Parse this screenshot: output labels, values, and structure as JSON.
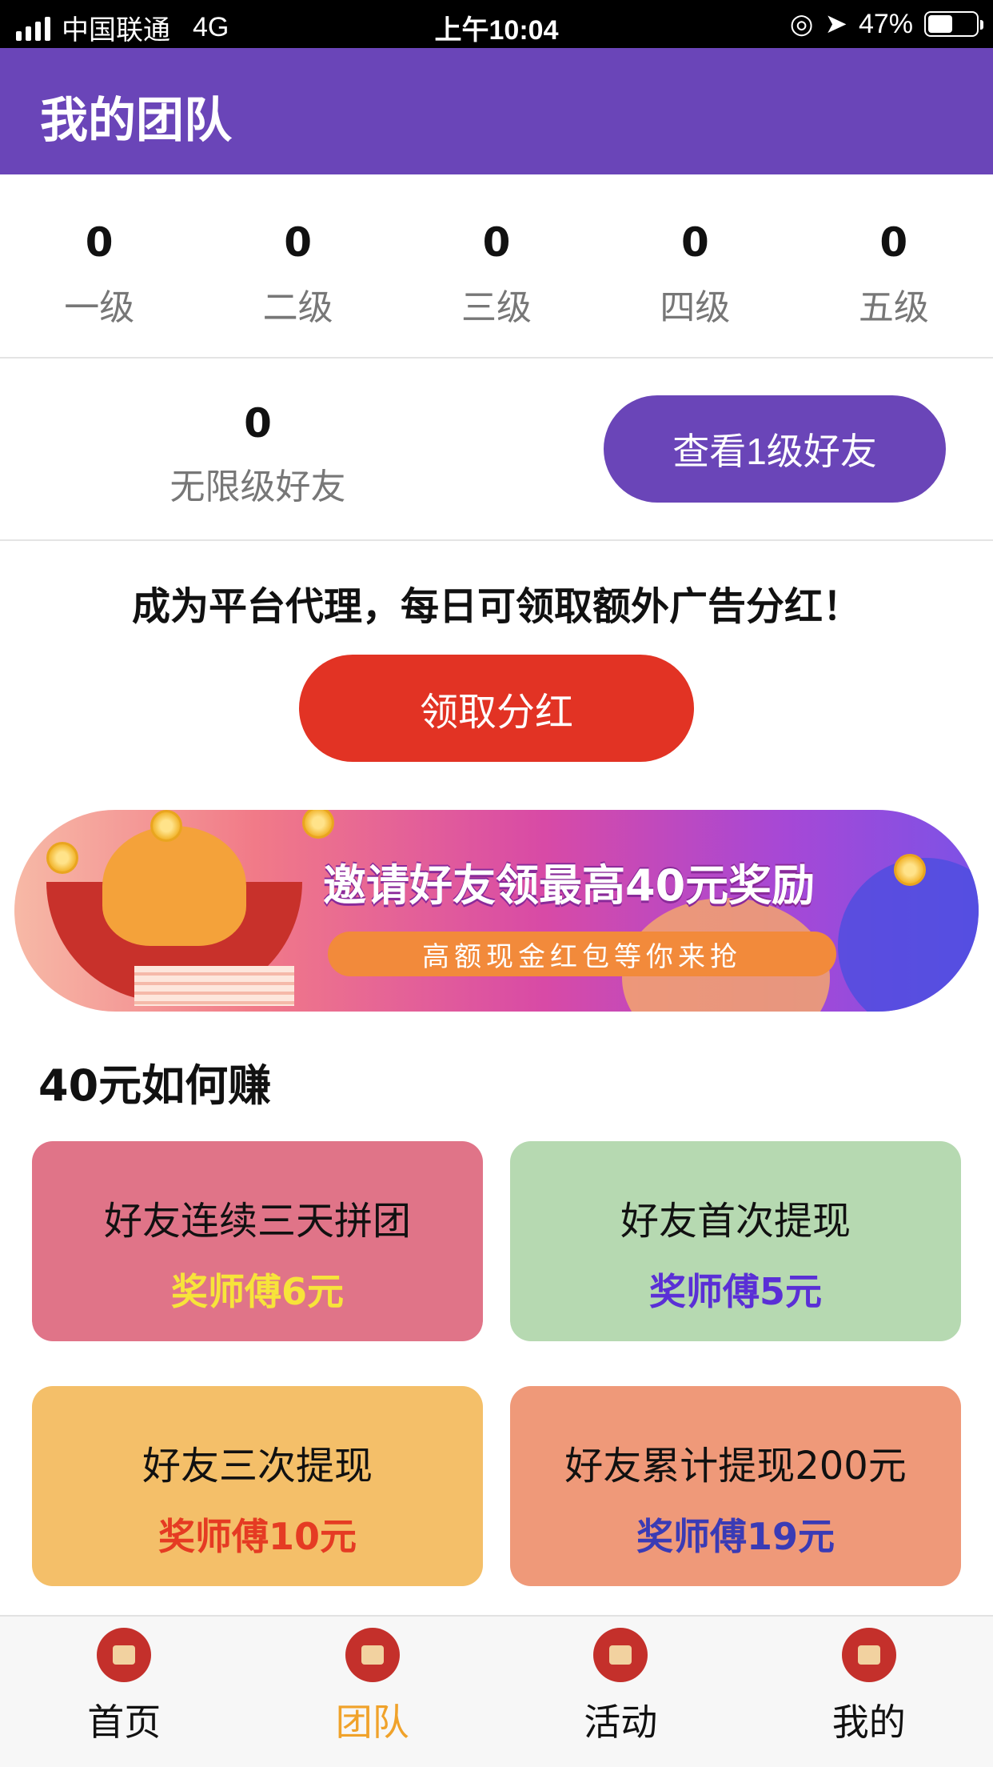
{
  "status_bar": {
    "carrier": "中国联通",
    "network": "4G",
    "time": "上午10:04",
    "battery": "47%"
  },
  "header": {
    "title": "我的团队"
  },
  "levels": [
    {
      "count": "0",
      "label": "一级"
    },
    {
      "count": "0",
      "label": "二级"
    },
    {
      "count": "0",
      "label": "三级"
    },
    {
      "count": "0",
      "label": "四级"
    },
    {
      "count": "0",
      "label": "五级"
    }
  ],
  "unlimited": {
    "count": "0",
    "label": "无限级好友"
  },
  "view_friends_button": "查看1级好友",
  "promo_text": "成为平台代理，每日可领取额外广告分红！",
  "claim_button": "领取分红",
  "banner": {
    "title": "邀请好友领最高40元奖励",
    "subtitle": "高额现金红包等你来抢"
  },
  "howto_title": "40元如何赚",
  "cards": [
    {
      "title": "好友连续三天拼团",
      "reward": "奖师傅6元",
      "reward_color": "#f7e43a"
    },
    {
      "title": "好友首次提现",
      "reward": "奖师傅5元",
      "reward_color": "#5a2fd6"
    },
    {
      "title": "好友三次提现",
      "reward": "奖师傅10元",
      "reward_color": "#e53b23"
    },
    {
      "title": "好友累计提现200元",
      "reward": "奖师傅19元",
      "reward_color": "#3a3bb5"
    }
  ],
  "tabs": [
    {
      "label": "首页",
      "icon": "home-icon"
    },
    {
      "label": "团队",
      "icon": "team-icon"
    },
    {
      "label": "活动",
      "icon": "activity-icon"
    },
    {
      "label": "我的",
      "icon": "profile-icon"
    }
  ],
  "active_tab": "团队"
}
